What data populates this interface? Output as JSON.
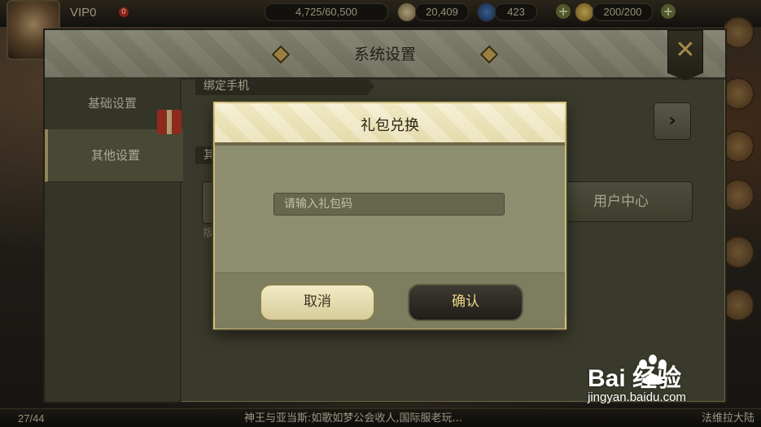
{
  "topbar": {
    "vip_label": "VIP0",
    "vip_badge": "0",
    "resource_progress": "4,725/60,500",
    "silver": "20,409",
    "gems": "423",
    "stamina": "200/200"
  },
  "bottombar": {
    "count": "27/44",
    "ticker": "神王与亚当斯:如歌如梦公会收人,国际服老玩...",
    "right_text": "法维拉大陆"
  },
  "settings": {
    "title": "系统设置",
    "close_symbol": "✕",
    "nav": [
      {
        "label": "基础设置"
      },
      {
        "label": "其他设置"
      }
    ],
    "bind_phone_label": "绑定手机",
    "other_section_label": "其",
    "user_center_label": "用户中心",
    "arrow_symbol": "›",
    "version_fragment": "版"
  },
  "gift_dialog": {
    "title": "礼包兑换",
    "input_placeholder": "请输入礼包码",
    "input_value": "",
    "cancel_label": "取消",
    "confirm_label": "确认"
  },
  "watermark": {
    "brand": "Bai  经验",
    "url": "jingyan.baidu.com"
  },
  "icons": {
    "close": "close-icon",
    "arrow": "chevron-right-icon",
    "gift": "gift-icon"
  },
  "colors": {
    "panel": "#51513d",
    "dialog_header": "#f3ecc8",
    "confirm_text": "#f0d68a"
  }
}
